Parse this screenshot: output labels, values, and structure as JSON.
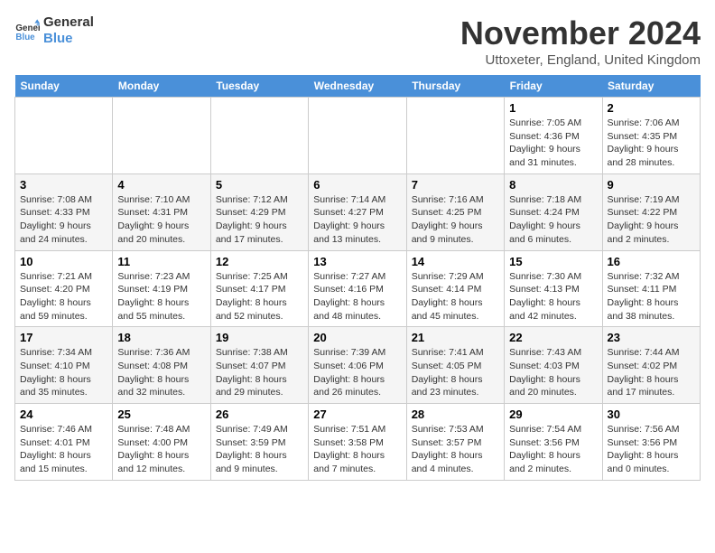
{
  "logo": {
    "text_general": "General",
    "text_blue": "Blue"
  },
  "header": {
    "month": "November 2024",
    "location": "Uttoxeter, England, United Kingdom"
  },
  "weekdays": [
    "Sunday",
    "Monday",
    "Tuesday",
    "Wednesday",
    "Thursday",
    "Friday",
    "Saturday"
  ],
  "weeks": [
    [
      {
        "day": "",
        "info": ""
      },
      {
        "day": "",
        "info": ""
      },
      {
        "day": "",
        "info": ""
      },
      {
        "day": "",
        "info": ""
      },
      {
        "day": "",
        "info": ""
      },
      {
        "day": "1",
        "info": "Sunrise: 7:05 AM\nSunset: 4:36 PM\nDaylight: 9 hours\nand 31 minutes."
      },
      {
        "day": "2",
        "info": "Sunrise: 7:06 AM\nSunset: 4:35 PM\nDaylight: 9 hours\nand 28 minutes."
      }
    ],
    [
      {
        "day": "3",
        "info": "Sunrise: 7:08 AM\nSunset: 4:33 PM\nDaylight: 9 hours\nand 24 minutes."
      },
      {
        "day": "4",
        "info": "Sunrise: 7:10 AM\nSunset: 4:31 PM\nDaylight: 9 hours\nand 20 minutes."
      },
      {
        "day": "5",
        "info": "Sunrise: 7:12 AM\nSunset: 4:29 PM\nDaylight: 9 hours\nand 17 minutes."
      },
      {
        "day": "6",
        "info": "Sunrise: 7:14 AM\nSunset: 4:27 PM\nDaylight: 9 hours\nand 13 minutes."
      },
      {
        "day": "7",
        "info": "Sunrise: 7:16 AM\nSunset: 4:25 PM\nDaylight: 9 hours\nand 9 minutes."
      },
      {
        "day": "8",
        "info": "Sunrise: 7:18 AM\nSunset: 4:24 PM\nDaylight: 9 hours\nand 6 minutes."
      },
      {
        "day": "9",
        "info": "Sunrise: 7:19 AM\nSunset: 4:22 PM\nDaylight: 9 hours\nand 2 minutes."
      }
    ],
    [
      {
        "day": "10",
        "info": "Sunrise: 7:21 AM\nSunset: 4:20 PM\nDaylight: 8 hours\nand 59 minutes."
      },
      {
        "day": "11",
        "info": "Sunrise: 7:23 AM\nSunset: 4:19 PM\nDaylight: 8 hours\nand 55 minutes."
      },
      {
        "day": "12",
        "info": "Sunrise: 7:25 AM\nSunset: 4:17 PM\nDaylight: 8 hours\nand 52 minutes."
      },
      {
        "day": "13",
        "info": "Sunrise: 7:27 AM\nSunset: 4:16 PM\nDaylight: 8 hours\nand 48 minutes."
      },
      {
        "day": "14",
        "info": "Sunrise: 7:29 AM\nSunset: 4:14 PM\nDaylight: 8 hours\nand 45 minutes."
      },
      {
        "day": "15",
        "info": "Sunrise: 7:30 AM\nSunset: 4:13 PM\nDaylight: 8 hours\nand 42 minutes."
      },
      {
        "day": "16",
        "info": "Sunrise: 7:32 AM\nSunset: 4:11 PM\nDaylight: 8 hours\nand 38 minutes."
      }
    ],
    [
      {
        "day": "17",
        "info": "Sunrise: 7:34 AM\nSunset: 4:10 PM\nDaylight: 8 hours\nand 35 minutes."
      },
      {
        "day": "18",
        "info": "Sunrise: 7:36 AM\nSunset: 4:08 PM\nDaylight: 8 hours\nand 32 minutes."
      },
      {
        "day": "19",
        "info": "Sunrise: 7:38 AM\nSunset: 4:07 PM\nDaylight: 8 hours\nand 29 minutes."
      },
      {
        "day": "20",
        "info": "Sunrise: 7:39 AM\nSunset: 4:06 PM\nDaylight: 8 hours\nand 26 minutes."
      },
      {
        "day": "21",
        "info": "Sunrise: 7:41 AM\nSunset: 4:05 PM\nDaylight: 8 hours\nand 23 minutes."
      },
      {
        "day": "22",
        "info": "Sunrise: 7:43 AM\nSunset: 4:03 PM\nDaylight: 8 hours\nand 20 minutes."
      },
      {
        "day": "23",
        "info": "Sunrise: 7:44 AM\nSunset: 4:02 PM\nDaylight: 8 hours\nand 17 minutes."
      }
    ],
    [
      {
        "day": "24",
        "info": "Sunrise: 7:46 AM\nSunset: 4:01 PM\nDaylight: 8 hours\nand 15 minutes."
      },
      {
        "day": "25",
        "info": "Sunrise: 7:48 AM\nSunset: 4:00 PM\nDaylight: 8 hours\nand 12 minutes."
      },
      {
        "day": "26",
        "info": "Sunrise: 7:49 AM\nSunset: 3:59 PM\nDaylight: 8 hours\nand 9 minutes."
      },
      {
        "day": "27",
        "info": "Sunrise: 7:51 AM\nSunset: 3:58 PM\nDaylight: 8 hours\nand 7 minutes."
      },
      {
        "day": "28",
        "info": "Sunrise: 7:53 AM\nSunset: 3:57 PM\nDaylight: 8 hours\nand 4 minutes."
      },
      {
        "day": "29",
        "info": "Sunrise: 7:54 AM\nSunset: 3:56 PM\nDaylight: 8 hours\nand 2 minutes."
      },
      {
        "day": "30",
        "info": "Sunrise: 7:56 AM\nSunset: 3:56 PM\nDaylight: 8 hours\nand 0 minutes."
      }
    ]
  ]
}
